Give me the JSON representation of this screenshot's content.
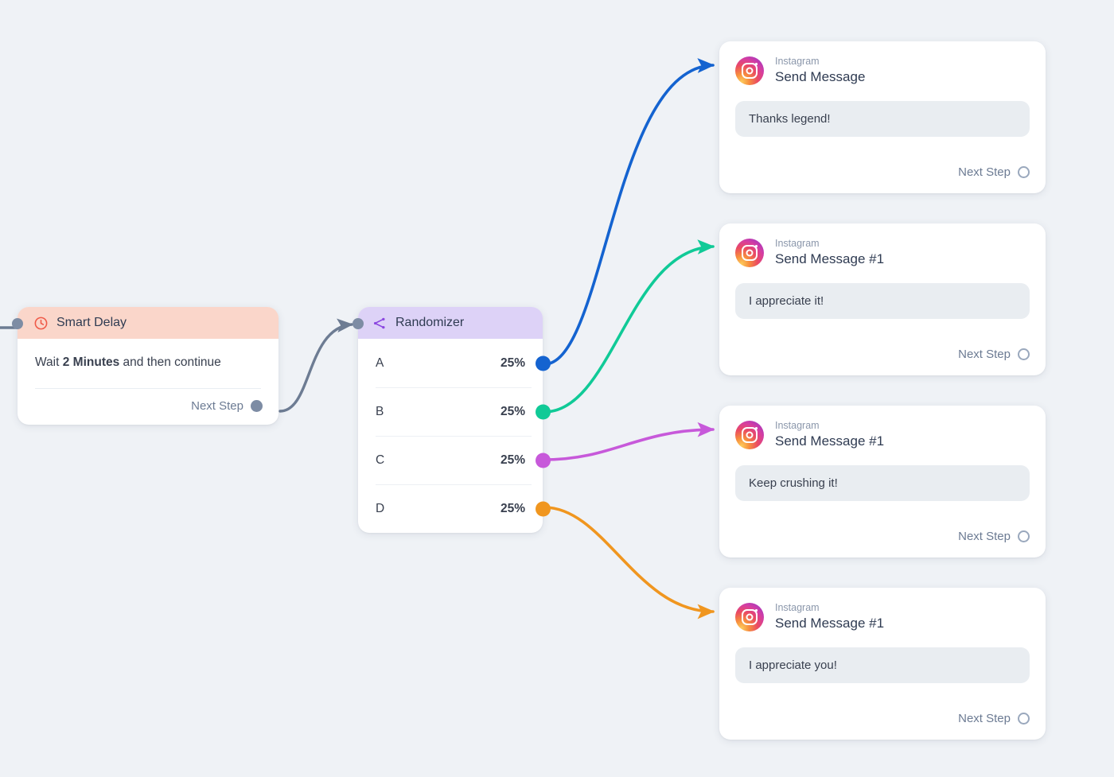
{
  "canvas": {
    "background": "#eff2f6"
  },
  "incoming_arrow": {
    "name": "incoming-connector"
  },
  "smart_delay": {
    "icon": "clock-icon",
    "title": "Smart Delay",
    "header_color": "#fad6ca",
    "icon_color": "#ef5a48",
    "body_prefix": "Wait ",
    "body_bold": "2 Minutes",
    "body_suffix": " and then continue",
    "next_step_label": "Next Step"
  },
  "randomizer": {
    "icon": "split-branch-icon",
    "title": "Randomizer",
    "header_color": "#ddd2f7",
    "icon_color": "#8b47e0",
    "rows": [
      {
        "key": "A",
        "percent": "25%",
        "port_color": "#1463d0"
      },
      {
        "key": "B",
        "percent": "25%",
        "port_color": "#10ca97"
      },
      {
        "key": "C",
        "percent": "25%",
        "port_color": "#c759da"
      },
      {
        "key": "D",
        "percent": "25%",
        "port_color": "#f0961f"
      }
    ]
  },
  "messages": [
    {
      "platform": "Instagram",
      "title": "Send Message",
      "text": "Thanks legend!",
      "next_step_label": "Next Step",
      "edge_color": "#1463d0"
    },
    {
      "platform": "Instagram",
      "title": "Send Message #1",
      "text": "I appreciate it!",
      "next_step_label": "Next Step",
      "edge_color": "#10ca97"
    },
    {
      "platform": "Instagram",
      "title": "Send Message #1",
      "text": "Keep crushing it!",
      "next_step_label": "Next Step",
      "edge_color": "#c759da"
    },
    {
      "platform": "Instagram",
      "title": "Send Message #1",
      "text": "I appreciate you!",
      "next_step_label": "Next Step",
      "edge_color": "#f0961f"
    }
  ],
  "edges": {
    "delay_to_randomizer_color": "#6d7c93"
  }
}
